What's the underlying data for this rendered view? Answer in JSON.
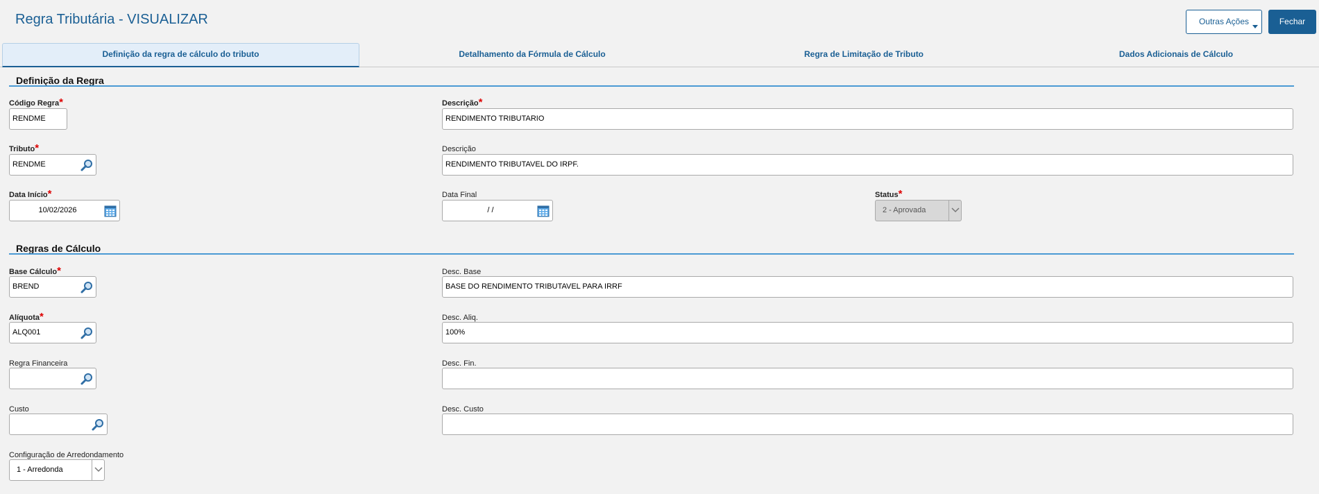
{
  "header": {
    "title": "Regra Tributária - VISUALIZAR",
    "outras_acoes": "Outras Ações",
    "fechar": "Fechar"
  },
  "tabs": [
    {
      "label": "Definição da regra de cálculo do tributo",
      "active": true
    },
    {
      "label": "Detalhamento da Fórmula de Cálculo",
      "active": false
    },
    {
      "label": "Regra de Limitação de Tributo",
      "active": false
    },
    {
      "label": "Dados Adicionais de Cálculo",
      "active": false
    }
  ],
  "definicao": {
    "section_title": "Definição da Regra",
    "codigo_regra": {
      "label": "Código Regra",
      "value": "RENDME"
    },
    "descricao": {
      "label": "Descrição",
      "value": "RENDIMENTO TRIBUTARIO"
    },
    "tributo": {
      "label": "Tributo",
      "value": "RENDME"
    },
    "descricao_tributo": {
      "label": "Descrição",
      "value": "RENDIMENTO TRIBUTAVEL DO IRPF."
    },
    "data_inicio": {
      "label": "Data Início",
      "value": "10/02/2026"
    },
    "data_final": {
      "label": "Data Final",
      "value": "/ /"
    },
    "status": {
      "label": "Status",
      "value": "2 - Aprovada"
    }
  },
  "calculo": {
    "section_title": "Regras de Cálculo",
    "base_calculo": {
      "label": "Base Cálculo",
      "value": "BREND"
    },
    "desc_base": {
      "label": "Desc. Base",
      "value": "BASE DO RENDIMENTO TRIBUTAVEL PARA IRRF"
    },
    "aliquota": {
      "label": "Alíquota",
      "value": "ALQ001"
    },
    "desc_aliq": {
      "label": "Desc. Aliq.",
      "value": "100%"
    },
    "regra_financeira": {
      "label": "Regra Financeira",
      "value": ""
    },
    "desc_fin": {
      "label": "Desc. Fin.",
      "value": ""
    },
    "custo": {
      "label": "Custo",
      "value": ""
    },
    "desc_custo": {
      "label": "Desc. Custo",
      "value": ""
    },
    "arredondamento": {
      "label": "Configuração de Arredondamento",
      "value": "1 - Arredonda"
    }
  },
  "colors": {
    "accent": "#1a5f94",
    "section_line": "#4a9ad4",
    "required_star": "#dd0000"
  }
}
